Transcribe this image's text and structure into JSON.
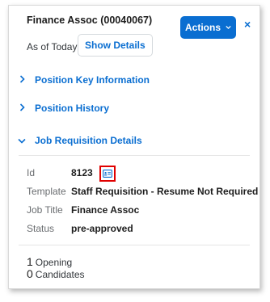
{
  "header": {
    "title": "Finance Assoc (00040067)",
    "as_of": "As of Today",
    "show_details": "Show Details",
    "actions": "Actions",
    "close_glyph": "×",
    "accent_color": "#0a6ed1"
  },
  "sections": [
    {
      "label": "Position Key Information",
      "expanded": false,
      "chevron": ">"
    },
    {
      "label": "Position History",
      "expanded": false,
      "chevron": ">"
    },
    {
      "label": "Job Requisition Details",
      "expanded": true,
      "chevron": "v"
    }
  ],
  "details": {
    "id": {
      "label": "Id",
      "value": "8123"
    },
    "template": {
      "label": "Template",
      "value": "Staff Requisition - Resume Not Required"
    },
    "job_title": {
      "label": "Job Title",
      "value": "Finance Assoc"
    },
    "status": {
      "label": "Status",
      "value": "pre-approved"
    },
    "highlight_color": "#e00000"
  },
  "stats": [
    {
      "count": "1",
      "label": "Opening"
    },
    {
      "count": "0",
      "label": "Candidates"
    }
  ]
}
